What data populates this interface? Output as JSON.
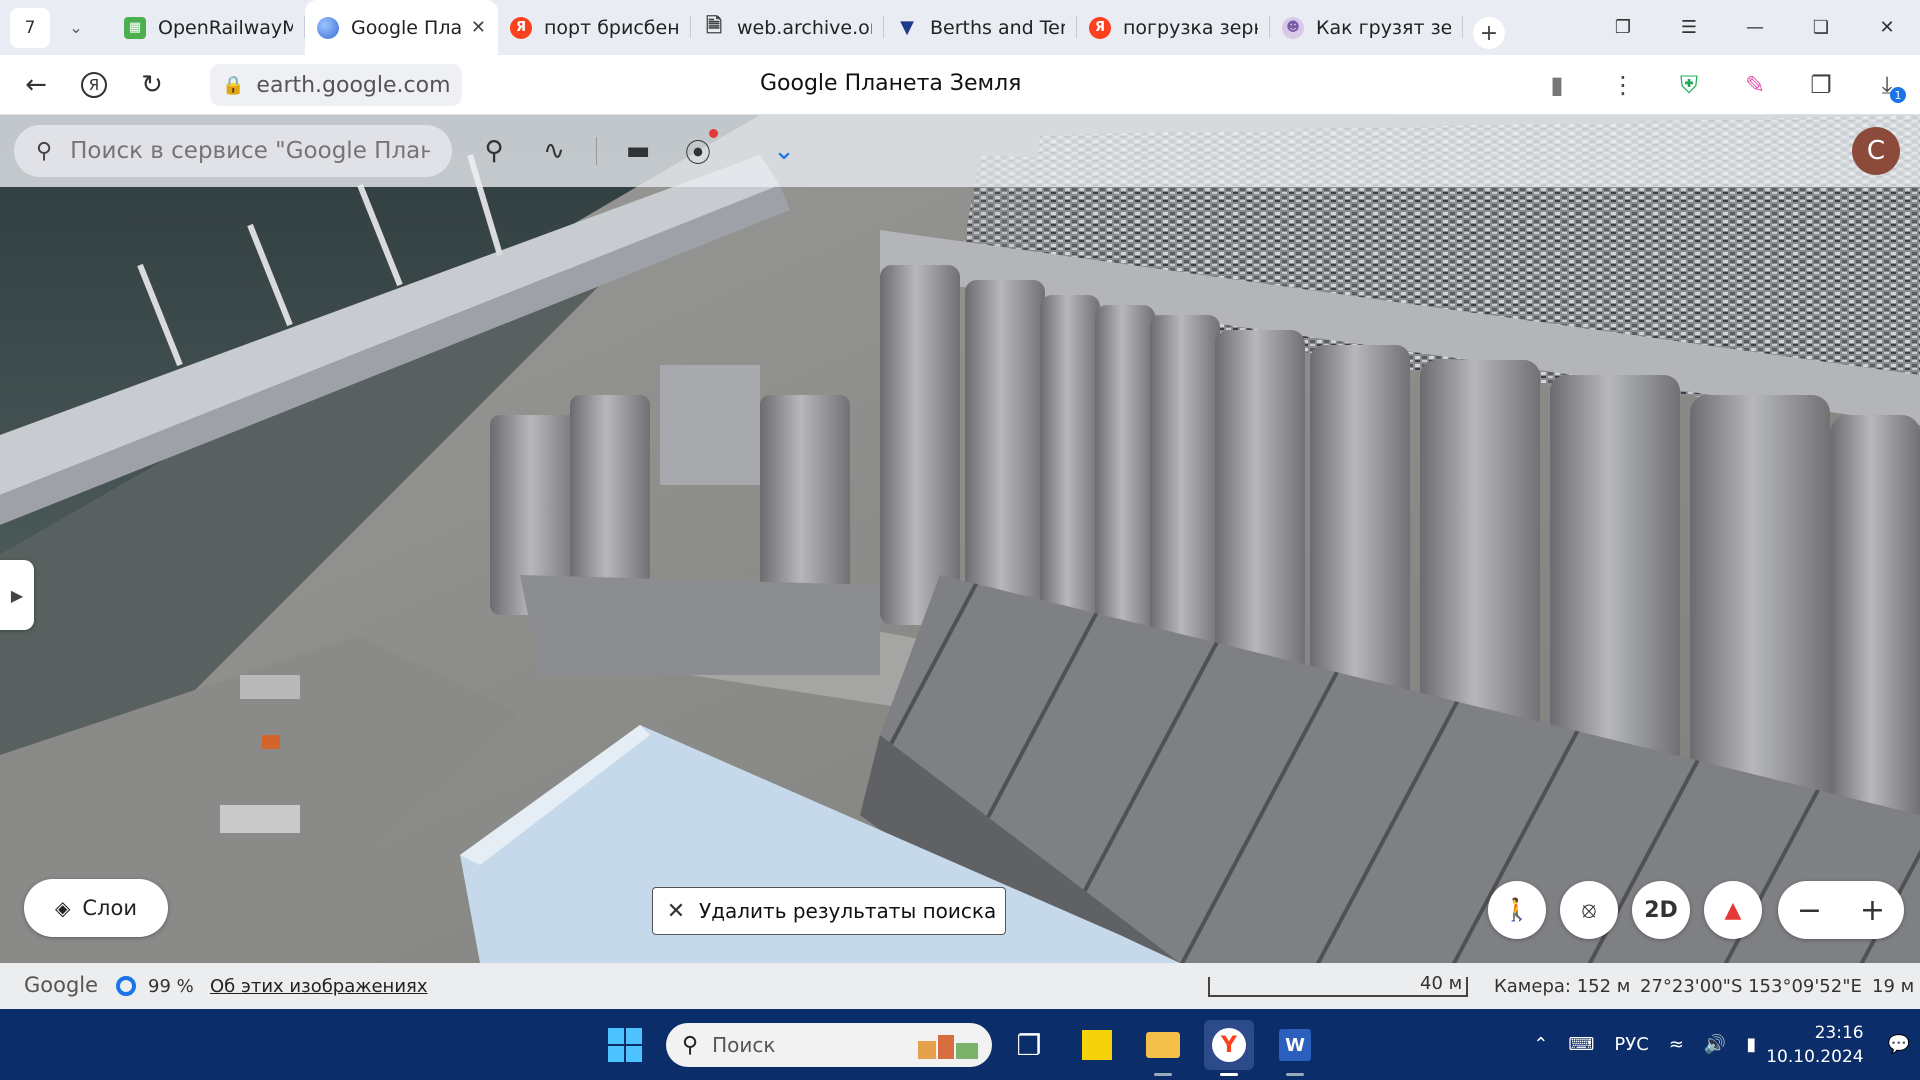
{
  "browser": {
    "tab_count": "7",
    "tabs": [
      {
        "title": "OpenRailwayM",
        "icon": "train-map-icon",
        "color": "#4caf50"
      },
      {
        "title": "Google Пла",
        "icon": "google-earth-icon",
        "color": "#4a7fd8"
      },
      {
        "title": "порт брисбен",
        "icon": "yandex-icon",
        "color": "#fc3f1d"
      },
      {
        "title": "web.archive.or",
        "icon": "document-icon",
        "color": "#666666"
      },
      {
        "title": "Berths and Ter",
        "icon": "triangle-flag-icon",
        "color": "#1d3a8a"
      },
      {
        "title": "погрузка зерн",
        "icon": "yandex-icon",
        "color": "#fc3f1d"
      },
      {
        "title": "Как грузят зер",
        "icon": "person-icon",
        "color": "#7a5aa6"
      }
    ],
    "active_tab_index": 1,
    "url": "earth.google.com",
    "page_title": "Google Планета Земля"
  },
  "earth": {
    "search_placeholder": "Поиск в сервисе \"Google План...",
    "avatar_letter": "C",
    "layers_label": "Слои",
    "clear_search_label": "Удалить результаты поиска",
    "view_mode_label": "2D"
  },
  "status": {
    "brand": "Google",
    "load_percent": "99 %",
    "about_link": "Об этих изображениях",
    "scale_label": "40 м",
    "camera": "Камера: 152 м",
    "coordinates": "27°23'00\"S 153°09'52\"E",
    "elevation": "19 м"
  },
  "taskbar": {
    "search_placeholder": "Поиск",
    "language": "РУС",
    "time": "23:16",
    "date": "10.10.2024"
  },
  "colors": {
    "accent": "#1a73e8",
    "taskbar_bg": "#0b2d6a",
    "avatar_bg": "#8b4a3a"
  }
}
